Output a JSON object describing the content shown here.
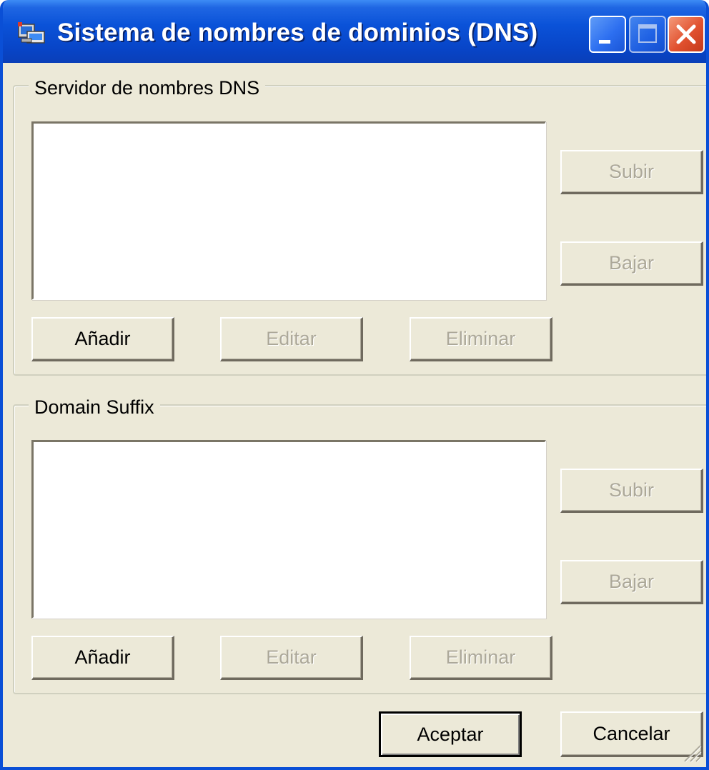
{
  "window": {
    "title": "Sistema de nombres de dominios (DNS)",
    "icon": "network-dns-icon"
  },
  "dns_servers": {
    "label": "Servidor de nombres DNS",
    "items": [],
    "buttons": {
      "up": "Subir",
      "down": "Bajar",
      "add": "Añadir",
      "edit": "Editar",
      "remove": "Eliminar"
    }
  },
  "domain_suffix": {
    "label": "Domain Suffix",
    "items": [],
    "buttons": {
      "up": "Subir",
      "down": "Bajar",
      "add": "Añadir",
      "edit": "Editar",
      "remove": "Eliminar"
    }
  },
  "footer": {
    "ok": "Aceptar",
    "cancel": "Cancelar"
  },
  "colors": {
    "titlebar": "#0a52d8",
    "face": "#ece9d8",
    "close": "#e1512f",
    "disabled_text": "#aca899"
  }
}
